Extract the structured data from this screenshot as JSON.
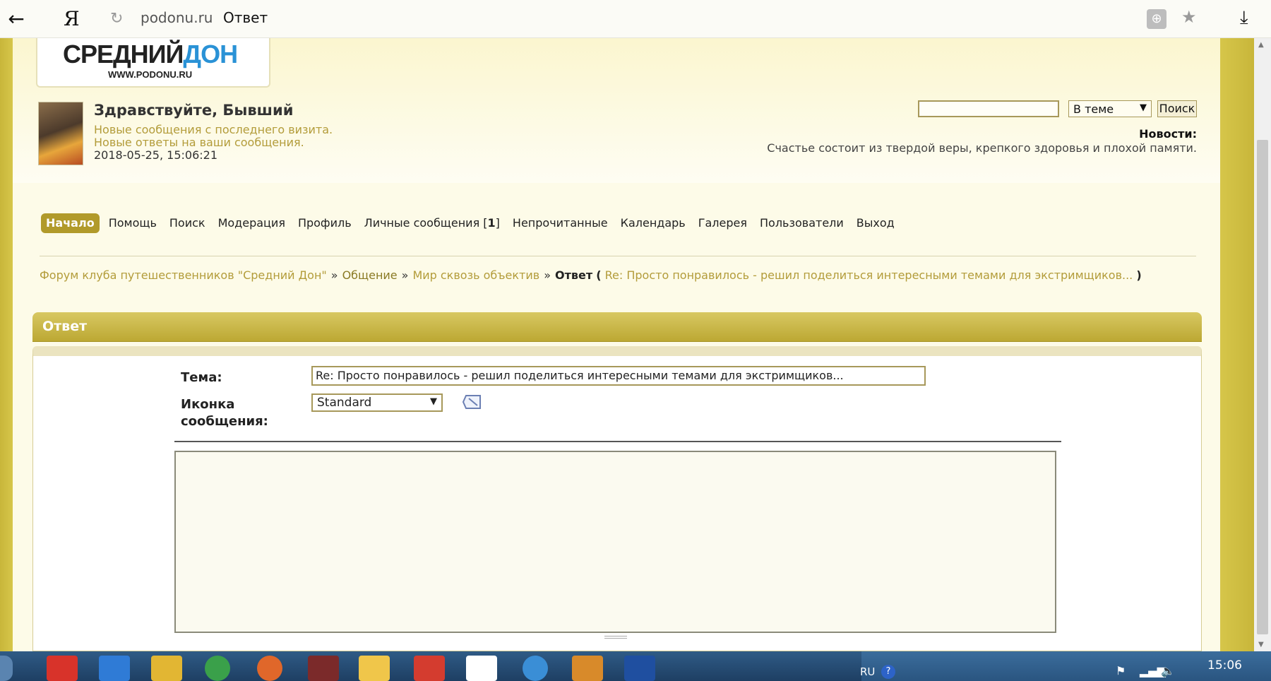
{
  "browser": {
    "logo": "Я",
    "domain": "podonu.ru",
    "title": "Ответ"
  },
  "site": {
    "logo_main_prefix": "СРЕДНИЙ",
    "logo_main_accent": "ДОН",
    "logo_sub": "WWW.PODONU.RU"
  },
  "user": {
    "greeting": "Здравствуйте, Бывший",
    "new_messages": "Новые сообщения с последнего визита.",
    "new_replies": "Новые ответы на ваши сообщения.",
    "timestamp": "2018-05-25, 15:06:21"
  },
  "search": {
    "value": "",
    "scope": "В теме",
    "button": "Поиск"
  },
  "news": {
    "label": "Новости:",
    "text": "Счастье состоит из твердой веры, крепкого здоровья и плохой памяти."
  },
  "nav": {
    "items": [
      {
        "label": "Начало"
      },
      {
        "label": "Помощь"
      },
      {
        "label": "Поиск"
      },
      {
        "label": "Модерация"
      },
      {
        "label": "Профиль"
      },
      {
        "label": "Личные сообщения ["
      },
      {
        "label": "Непрочитанные"
      },
      {
        "label": "Календарь"
      },
      {
        "label": "Галерея"
      },
      {
        "label": "Пользователи"
      },
      {
        "label": "Выход"
      }
    ],
    "pm_count": "1",
    "pm_close": "]"
  },
  "breadcrumb": {
    "forum": "Форум клуба путешественников \"Средний Дон\"",
    "board": "Общение",
    "subboard": "Мир сквозь объектив",
    "current": "Ответ",
    "open_paren": "(",
    "topic": "Re: Просто понравилось - решил поделиться интересными темами для экстримщиков...",
    "close_paren": ")",
    "separator": "»"
  },
  "form": {
    "panel_title": "Ответ",
    "topic_label": "Тема:",
    "topic_value": "Re: Просто понравилось - решил поделиться интересными темами для экстримщиков...",
    "icon_label": "Иконка сообщения:",
    "icon_value": "Standard",
    "message_value": ""
  },
  "taskbar": {
    "lang": "RU",
    "help": "?",
    "time": "15:06"
  }
}
